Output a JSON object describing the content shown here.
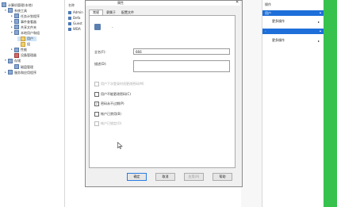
{
  "tree": {
    "root": "计算机管理(本地)",
    "items": [
      {
        "label": "系统工具",
        "level": 1,
        "expand": "▾"
      },
      {
        "label": "任务计划程序",
        "level": 2,
        "expand": "▸"
      },
      {
        "label": "事件查看器",
        "level": 2,
        "expand": "▸"
      },
      {
        "label": "共享文件夹",
        "level": 2,
        "expand": "▸"
      },
      {
        "label": "本地用户和组",
        "level": 2,
        "expand": "▾"
      },
      {
        "label": "用户",
        "level": 3,
        "expand": ""
      },
      {
        "label": "组",
        "level": 3,
        "expand": ""
      },
      {
        "label": "性能",
        "level": 2,
        "expand": "▸"
      },
      {
        "label": "设备管理器",
        "level": 2,
        "expand": ""
      },
      {
        "label": "存储",
        "level": 1,
        "expand": "▾"
      },
      {
        "label": "磁盘管理",
        "level": 2,
        "expand": ""
      },
      {
        "label": "服务和应用程序",
        "level": 1,
        "expand": "▸"
      }
    ]
  },
  "list": {
    "header": "名称",
    "rows": [
      "Admin",
      "Defa",
      "Guest",
      "WDA"
    ]
  },
  "dialog": {
    "title": "属性",
    "tabs": [
      "常规",
      "隶属于",
      "配置文件"
    ],
    "username": "-",
    "fullname_label": "全名(F):",
    "fullname_value": "666",
    "desc_label": "描述(D):",
    "desc_value": "",
    "checkboxes": [
      {
        "label": "用户下次登录时须更改密码(M)",
        "checked": false,
        "disabled": true
      },
      {
        "label": "用户不能更改密码(C)",
        "checked": false,
        "disabled": false
      },
      {
        "label": "密码永不过期(P)",
        "checked": true,
        "disabled": false
      },
      {
        "label": "帐户已禁用(B)",
        "checked": false,
        "disabled": false
      },
      {
        "label": "帐户已锁定(O)",
        "checked": false,
        "disabled": true
      }
    ],
    "buttons": {
      "ok": "确定",
      "cancel": "取消",
      "apply": "应用(A)",
      "help": "帮助"
    }
  },
  "actions": {
    "header": "操作",
    "section1": "用户",
    "more1": "更多操作",
    "section2": "-",
    "more2": "更多操作"
  },
  "colors": {
    "accent": "#1e6fd9",
    "side_green": "#37c24e"
  }
}
